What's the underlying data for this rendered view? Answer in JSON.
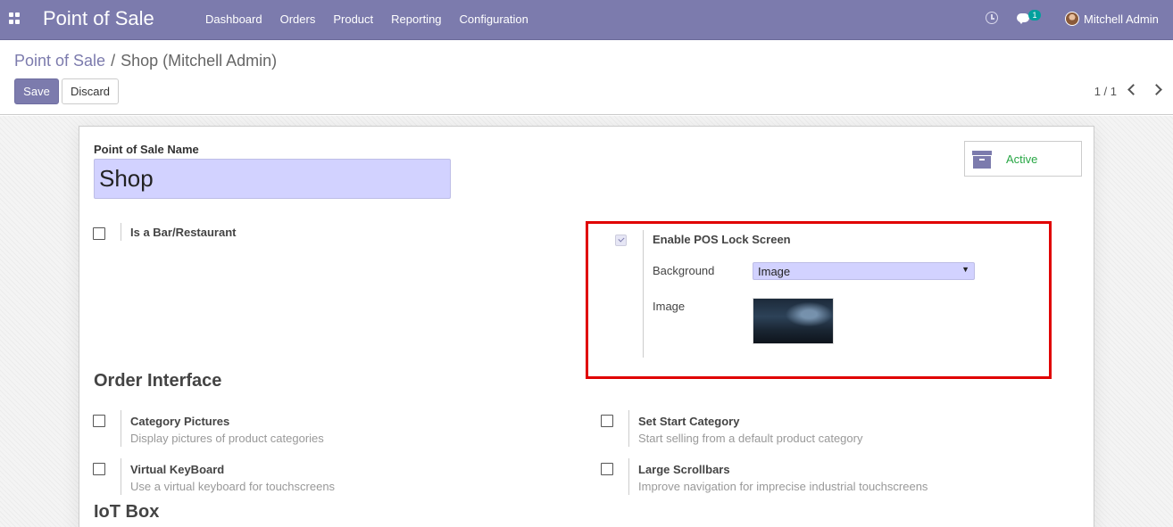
{
  "navbar": {
    "app_title": "Point of Sale",
    "menu": [
      "Dashboard",
      "Orders",
      "Product",
      "Reporting",
      "Configuration"
    ],
    "chat_badge": "1",
    "user_name": "Mitchell Admin"
  },
  "breadcrumb": {
    "parent": "Point of Sale",
    "separator": "/",
    "current": "Shop (Mitchell Admin)"
  },
  "buttons": {
    "save": "Save",
    "discard": "Discard"
  },
  "pager": "1 / 1",
  "form": {
    "name_label": "Point of Sale Name",
    "name_value": "Shop",
    "active_label": "Active",
    "bar_restaurant": "Is a Bar/Restaurant",
    "lock_screen": {
      "title": "Enable POS Lock Screen",
      "checked": true,
      "background_label": "Background",
      "background_value": "Image",
      "image_label": "Image"
    },
    "order_interface": {
      "title": "Order Interface",
      "options": [
        {
          "title": "Category Pictures",
          "desc": "Display pictures of product categories"
        },
        {
          "title": "Set Start Category",
          "desc": "Start selling from a default product category"
        },
        {
          "title": "Virtual KeyBoard",
          "desc": "Use a virtual keyboard for touchscreens"
        },
        {
          "title": "Large Scrollbars",
          "desc": "Improve navigation for imprecise industrial touchscreens"
        }
      ]
    },
    "iot_box_title": "IoT Box"
  },
  "colors": {
    "brand": "#7c7bad",
    "highlight_border": "#e00000",
    "active_green": "#28a745",
    "input_bg": "#d2d2ff"
  }
}
